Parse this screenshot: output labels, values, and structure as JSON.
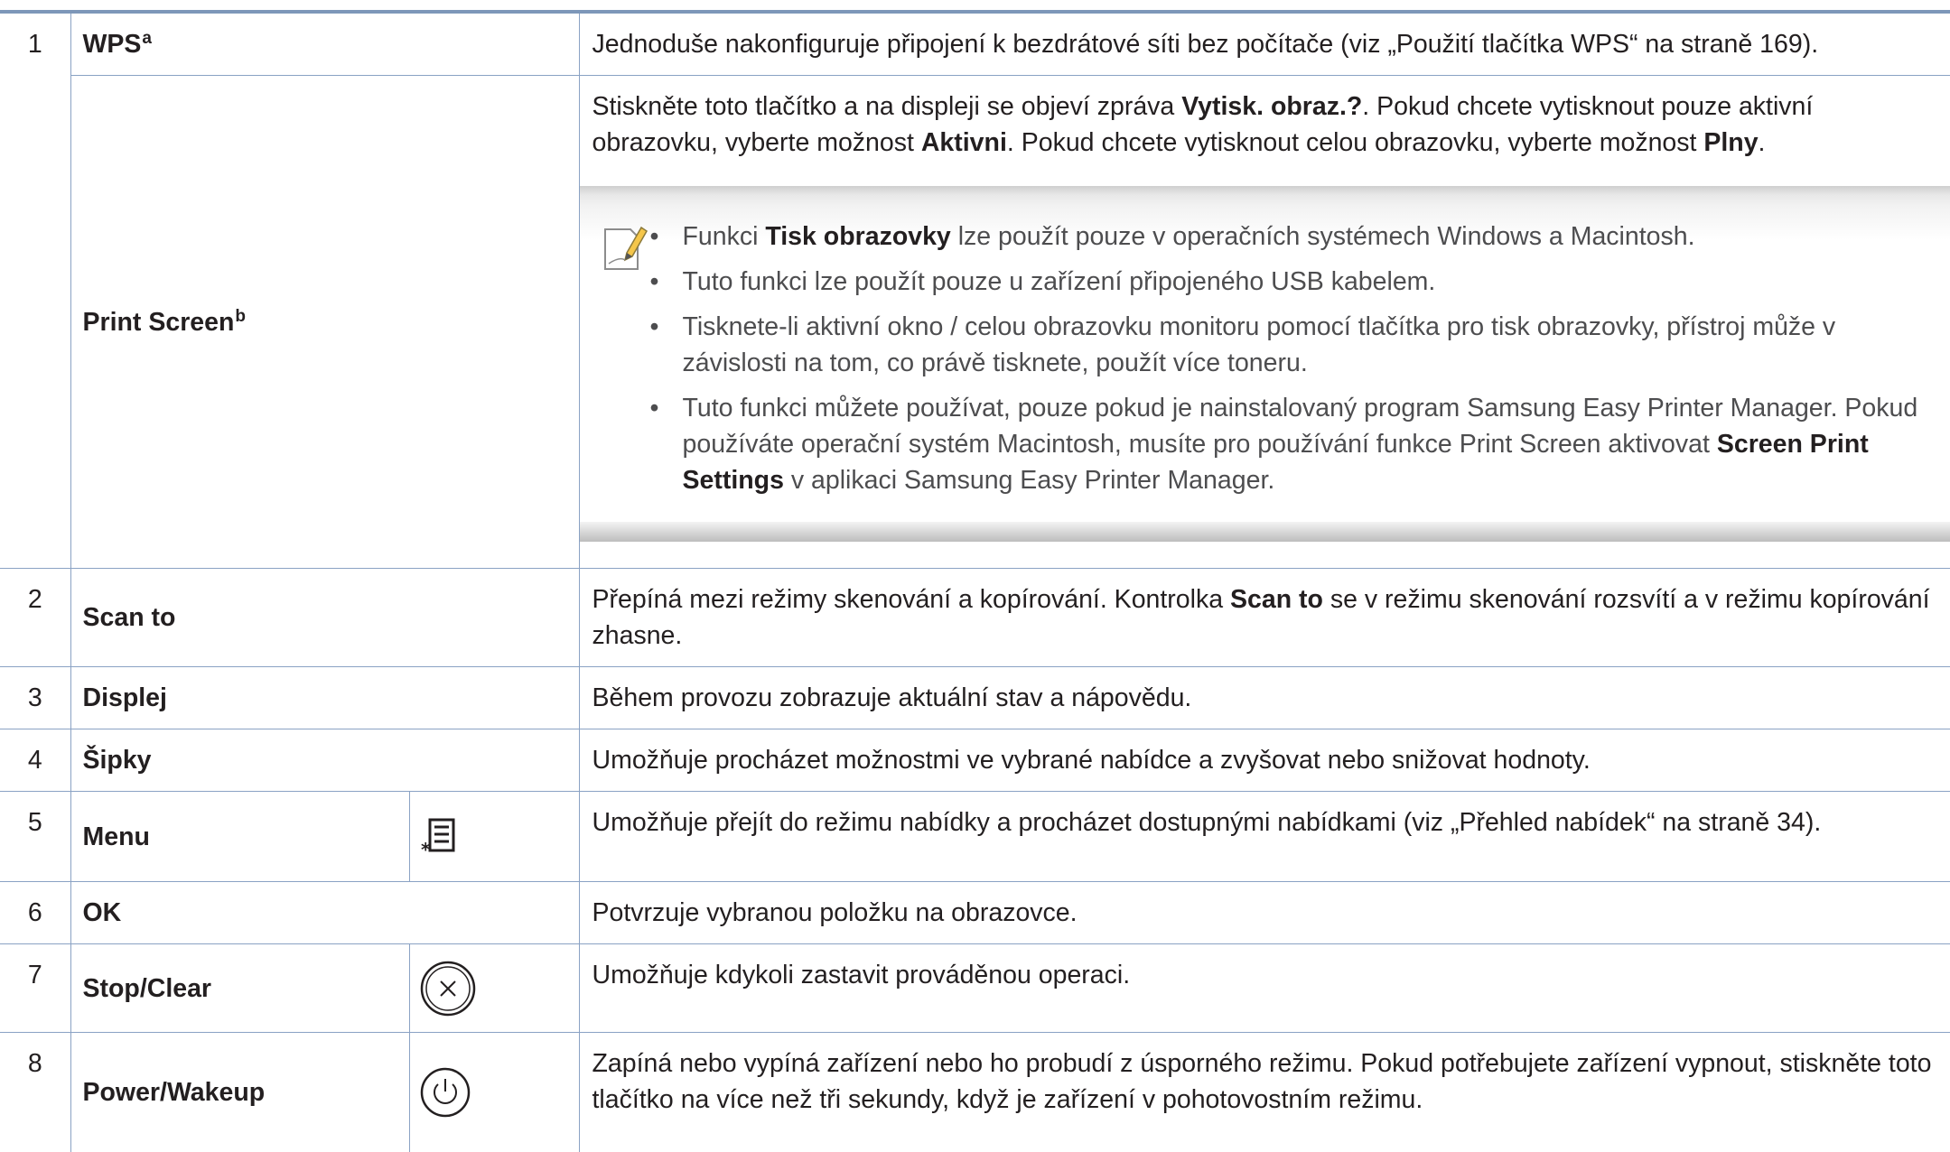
{
  "rows": [
    {
      "num": "1",
      "name": "WPS",
      "sup": "a",
      "desc": "Jednoduše nakonfiguruje připojení k bezdrátové síti bez počítače (viz „Použití tlačítka WPS“ na straně 169)."
    },
    {
      "name": "Print Screen",
      "sup": "b",
      "desc_a": "Stiskněte toto tlačítko a na displeji se objeví zpráva ",
      "desc_b": "Vytisk. obraz.?",
      "desc_c": ". Pokud chcete vytisknout pouze aktivní obrazovku, vyberte možnost ",
      "desc_d": "Aktivni",
      "desc_e": ". Pokud chcete vytisknout celou obrazovku, vyberte možnost ",
      "desc_f": "Plny",
      "desc_g": ".",
      "note": {
        "b1_a": "Funkci ",
        "b1_b": "Tisk obrazovky",
        "b1_c": " lze použít pouze v operačních systémech Windows a Macintosh.",
        "b2": "Tuto funkci lze použít pouze u zařízení připojeného USB kabelem.",
        "b3": "Tisknete-li aktivní okno / celou obrazovku monitoru pomocí tlačítka pro tisk obrazovky, přístroj může v závislosti na tom, co právě tisknete, použít více toneru.",
        "b4_a": "Tuto funkci můžete používat, pouze pokud je nainstalovaný program ",
        "b4_b": "Samsung Easy Printer Manager",
        "b4_c": ". Pokud používáte operační systém Macintosh, musíte pro používání funkce Print Screen aktivovat ",
        "b4_d": "Screen Print Settings",
        "b4_e": " v aplikaci Samsung Easy Printer Manager."
      }
    },
    {
      "num": "2",
      "name": "Scan to",
      "desc_a": "Přepíná mezi režimy skenování a kopírování. Kontrolka ",
      "desc_b": "Scan to",
      "desc_c": " se v režimu skenování rozsvítí a v režimu kopírování zhasne."
    },
    {
      "num": "3",
      "name": "Displej",
      "desc": "Během provozu zobrazuje aktuální stav a nápovědu."
    },
    {
      "num": "4",
      "name": "Šipky",
      "desc": "Umožňuje procházet možnostmi ve vybrané nabídce a zvyšovat nebo snižovat hodnoty."
    },
    {
      "num": "5",
      "name": "Menu",
      "icon": "menu-icon",
      "desc": "Umožňuje přejít do režimu nabídky a procházet dostupnými nabídkami (viz „Přehled nabídek“ na straně 34)."
    },
    {
      "num": "6",
      "name": "OK",
      "desc": "Potvrzuje vybranou položku na obrazovce."
    },
    {
      "num": "7",
      "name": "Stop/Clear",
      "icon": "stop-clear-icon",
      "desc": "Umožňuje kdykoli zastavit prováděnou operaci."
    },
    {
      "num": "8",
      "name": "Power/Wakeup",
      "icon": "power-icon",
      "desc": "Zapíná nebo vypíná zařízení nebo ho probudí z úsporného režimu. Pokud potřebujete zařízení vypnout, stiskněte toto tlačítko na více než tři sekundy, když je zařízení v pohotovostním režimu."
    }
  ]
}
